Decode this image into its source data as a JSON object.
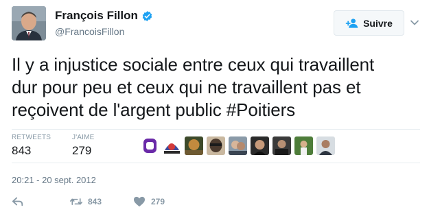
{
  "author": {
    "name": "François Fillon",
    "handle": "@FrancoisFillon"
  },
  "follow_button": {
    "label": "Suivre"
  },
  "tweet": {
    "line1": "Il y a injustice sociale entre ceux qui travaillent",
    "line2": "dur pour peu et ceux qui ne travaillent pas et",
    "line3": "reçoivent de l'argent public #Poitiers"
  },
  "stats": {
    "retweets_label": "RETWEETS",
    "retweets_value": "843",
    "likes_label": "J'AIME",
    "likes_value": "279"
  },
  "timestamp": "20:21 - 20 sept. 2012",
  "actions": {
    "retweet_count": "843",
    "like_count": "279"
  },
  "colors": {
    "verified": "#1da1f2",
    "follow_icon": "#1da1f2",
    "muted": "#8899a6"
  },
  "icons": [
    "verified-badge-icon",
    "follow-person-icon",
    "chevron-down-icon",
    "reply-icon",
    "retweet-icon",
    "like-icon"
  ]
}
